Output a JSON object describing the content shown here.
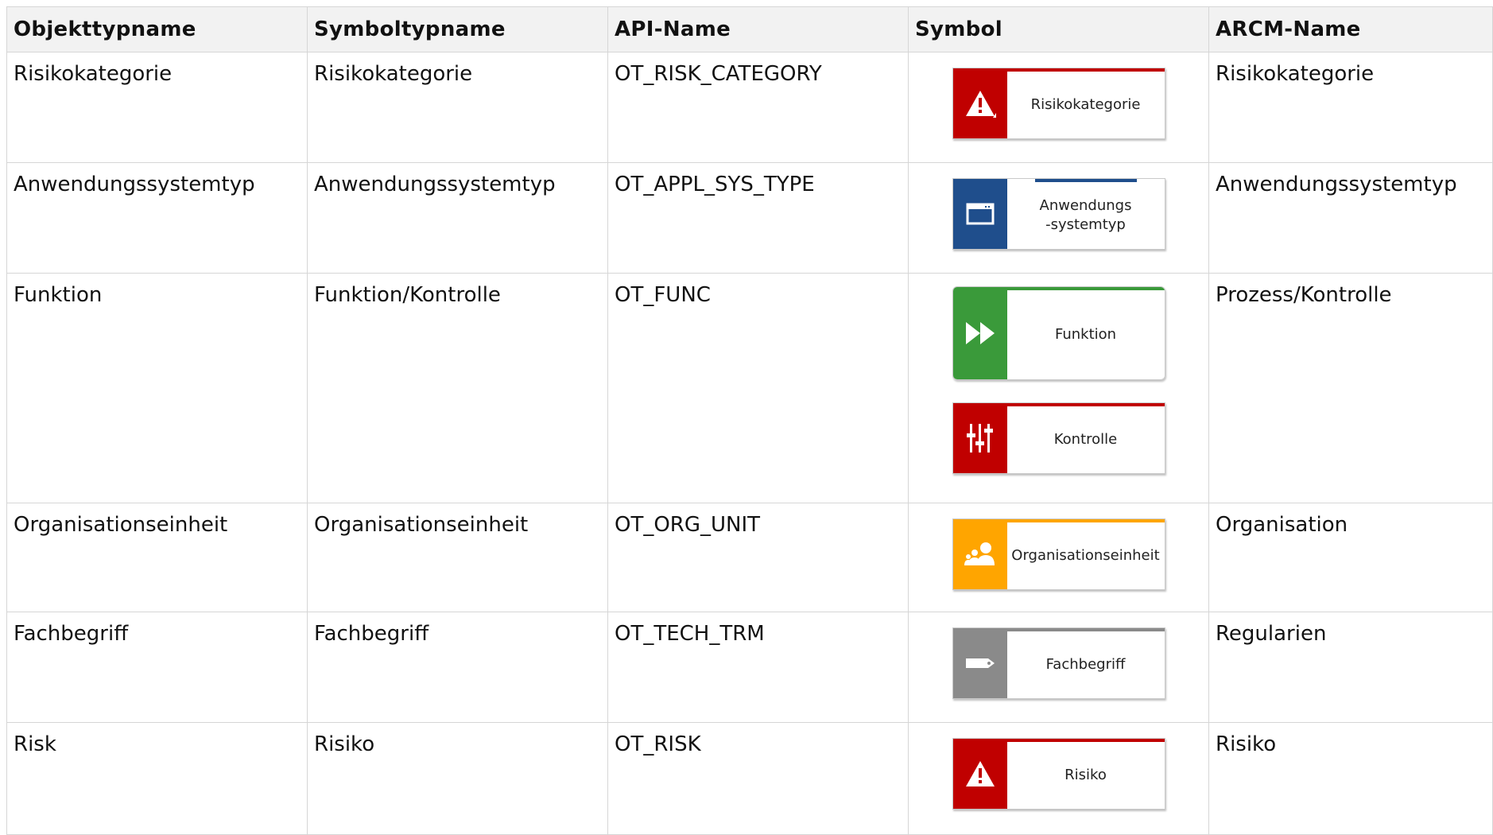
{
  "headers": [
    "Objekttypname",
    "Symboltypname",
    "API-Name",
    "Symbol",
    "ARCM-Name"
  ],
  "rows": [
    {
      "objekttyp": "Risikokategorie",
      "symboltyp": "Risikokategorie",
      "api": "OT_RISK_CATEGORY",
      "arcm": "Risikokategorie",
      "symbols": [
        {
          "label": "Risikokategorie",
          "icon": "warning-triangle-icon",
          "color": "#c00000"
        }
      ]
    },
    {
      "objekttyp": "Anwendungssystemtyp",
      "symboltyp": "Anwendungssystemtyp",
      "api": "OT_APPL_SYS_TYPE",
      "arcm": "Anwendungssystemtyp",
      "symbols": [
        {
          "label": "Anwendungs-systemtyp",
          "icon": "application-window-icon",
          "color": "#1f4e8c"
        }
      ]
    },
    {
      "objekttyp": "Funktion",
      "symboltyp": "Funktion/Kontrolle",
      "api": "OT_FUNC",
      "arcm": "Prozess/Kontrolle",
      "symbols": [
        {
          "label": "Funktion",
          "icon": "fast-forward-icon",
          "color": "#3a9a3a"
        },
        {
          "label": "Kontrolle",
          "icon": "sliders-icon",
          "color": "#c00000"
        }
      ]
    },
    {
      "objekttyp": "Organisationseinheit",
      "symboltyp": "Organisationseinheit",
      "api": "OT_ORG_UNIT",
      "arcm": "Organisation",
      "symbols": [
        {
          "label": "Organisationseinheit",
          "icon": "people-icon",
          "color": "#ffa500"
        }
      ]
    },
    {
      "objekttyp": "Fachbegriff",
      "symboltyp": "Fachbegriff",
      "api": "OT_TECH_TRM",
      "arcm": "Regularien",
      "symbols": [
        {
          "label": "Fachbegriff",
          "icon": "tag-icon",
          "color": "#8a8a8a"
        }
      ]
    },
    {
      "objekttyp": "Risk",
      "symboltyp": "Risiko",
      "api": "OT_RISK",
      "arcm": "Risiko",
      "symbols": [
        {
          "label": "Risiko",
          "icon": "warning-triangle-icon",
          "color": "#c00000"
        }
      ]
    }
  ]
}
